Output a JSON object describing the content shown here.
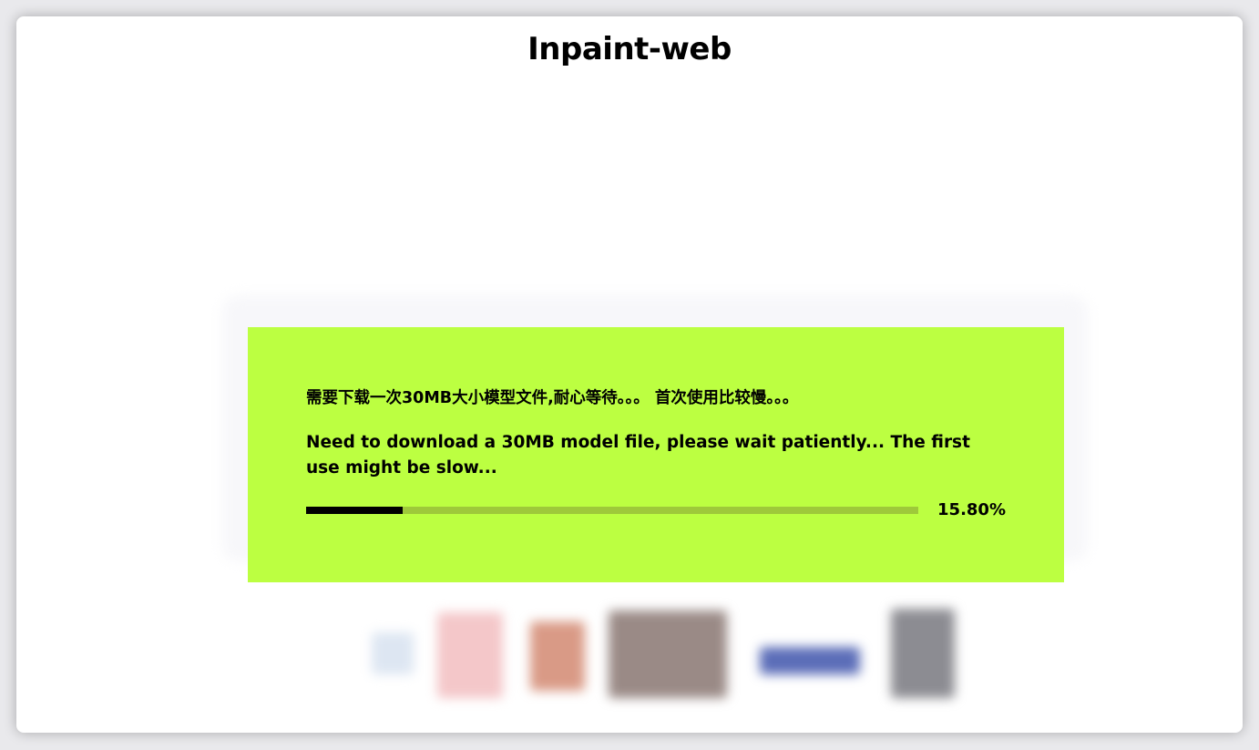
{
  "app": {
    "title": "Inpaint-web"
  },
  "loading_modal": {
    "message_cn": "需要下载一次30MB大小模型文件,耐心等待。。。 首次使用比较慢。。。",
    "message_en": "Need to download a 30MB model file, please wait patiently... The first use might be slow...",
    "progress_fraction": 0.158,
    "progress_label": "15.80%",
    "background_color": "#bcff41",
    "track_color": "#9ec93a",
    "fill_color": "#000000"
  },
  "examples": {
    "thumbnail_count": 6,
    "thumbnail_colors": [
      "#dde6f2",
      "#f4c7c9",
      "#d99a86",
      "#9a8a86",
      "#5b6db8",
      "#8c8c92"
    ]
  }
}
